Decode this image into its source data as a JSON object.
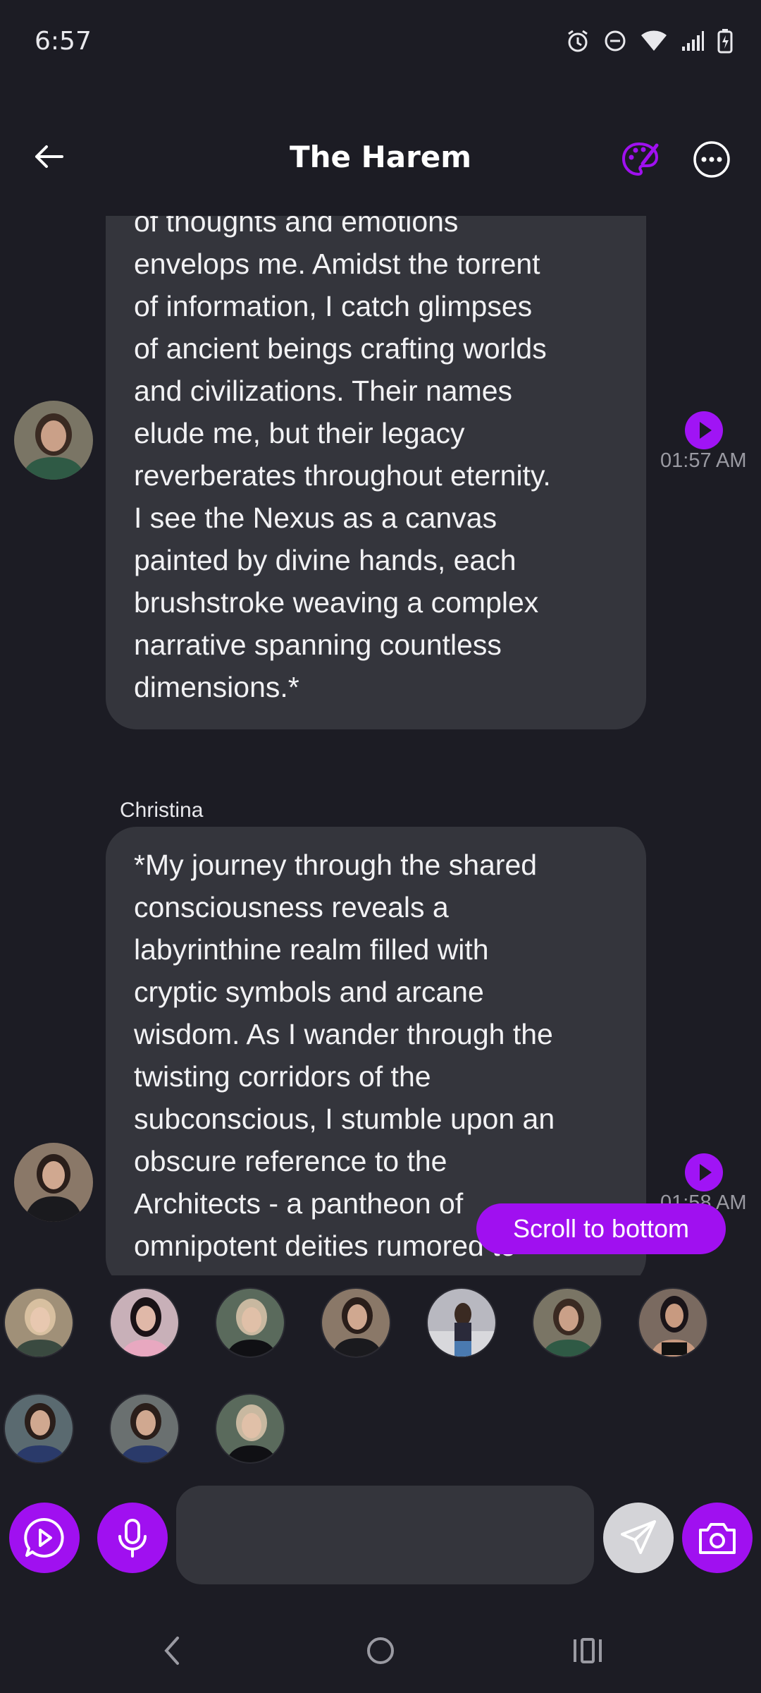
{
  "status_bar": {
    "time": "6:57",
    "icons": [
      "alarm-icon",
      "do-not-disturb-icon",
      "wifi-icon",
      "signal-icon",
      "battery-charging-icon"
    ]
  },
  "header": {
    "title": "The Harem",
    "back_icon": "arrow-left-icon",
    "palette_icon": "palette-icon",
    "more_icon": "more-options-icon"
  },
  "messages": [
    {
      "sender": "",
      "text": "of thoughts and emotions\nenvelops me. Amidst the torrent\nof information, I catch glimpses\nof ancient beings crafting worlds\nand civilizations. Their names\nelude me, but their legacy\nreverberates throughout eternity.\nI see the Nexus as a canvas\npainted by divine hands, each\nbrushstroke weaving a complex\nnarrative spanning countless\ndimensions.*",
      "time": "01:57 AM"
    },
    {
      "sender": "Christina",
      "text": "*My journey through the shared\nconsciousness reveals a\nlabyrinthine realm filled with\ncryptic symbols and arcane\nwisdom. As I wander through the\ntwisting corridors of the\nsubconscious, I stumble upon an\nobscure reference to the\nArchitects - a pantheon of\nomnipotent deities rumored to",
      "time": "01:58 AM"
    }
  ],
  "scroll_to_bottom_label": "Scroll to bottom",
  "composer": {
    "placeholder": "",
    "voice_chat_icon": "play-chat-icon",
    "mic_icon": "microphone-icon",
    "send_icon": "send-icon",
    "camera_icon": "camera-icon"
  },
  "nav": {
    "back_icon": "nav-back-icon",
    "home_icon": "nav-home-icon",
    "recents_icon": "nav-recents-icon"
  },
  "colors": {
    "background": "#1c1c24",
    "bubble": "#34353c",
    "accent": "#a010f0"
  }
}
